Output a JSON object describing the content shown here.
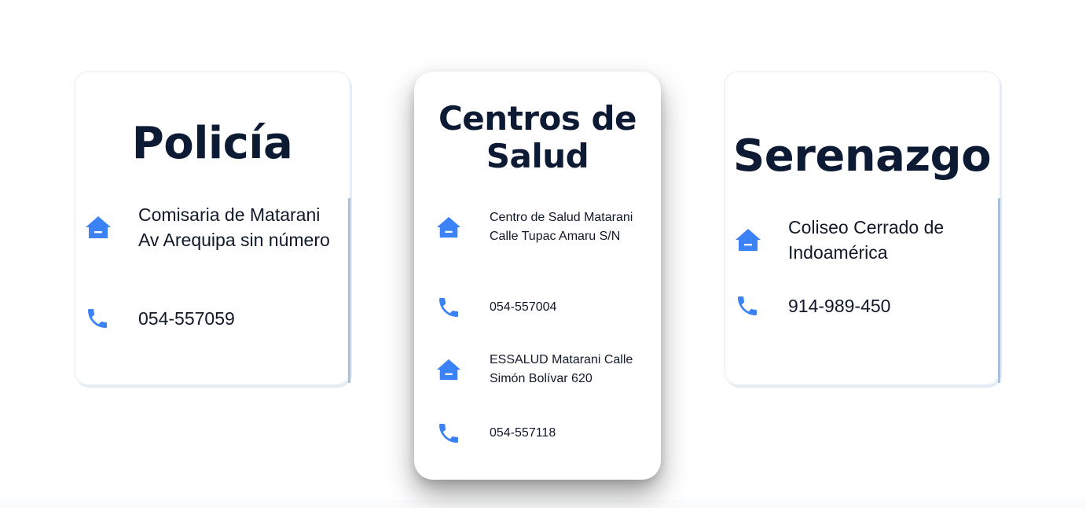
{
  "cards": [
    {
      "title": "Policía",
      "entries": [
        {
          "icon": "house-icon",
          "text": "Comisaria de Matarani Av Arequipa sin número"
        },
        {
          "icon": "phone-icon",
          "text": "054-557059"
        }
      ]
    },
    {
      "title": "Centros de Salud",
      "entries": [
        {
          "icon": "house-icon",
          "text": "Centro de Salud Matarani Calle Tupac Amaru S/N"
        },
        {
          "icon": "phone-icon",
          "text": "054-557004"
        },
        {
          "icon": "house-icon",
          "text": "ESSALUD Matarani Calle Simón Bolívar 620"
        },
        {
          "icon": "phone-icon",
          "text": "054-557118"
        }
      ]
    },
    {
      "title": "Serenazgo",
      "entries": [
        {
          "icon": "house-icon",
          "text": "Coliseo Cerrado de Indoamérica"
        },
        {
          "icon": "phone-icon",
          "text": "914-989-450"
        }
      ]
    }
  ],
  "colors": {
    "icon": "#3b82f6",
    "title": "#0d1a33",
    "text": "#111827"
  }
}
